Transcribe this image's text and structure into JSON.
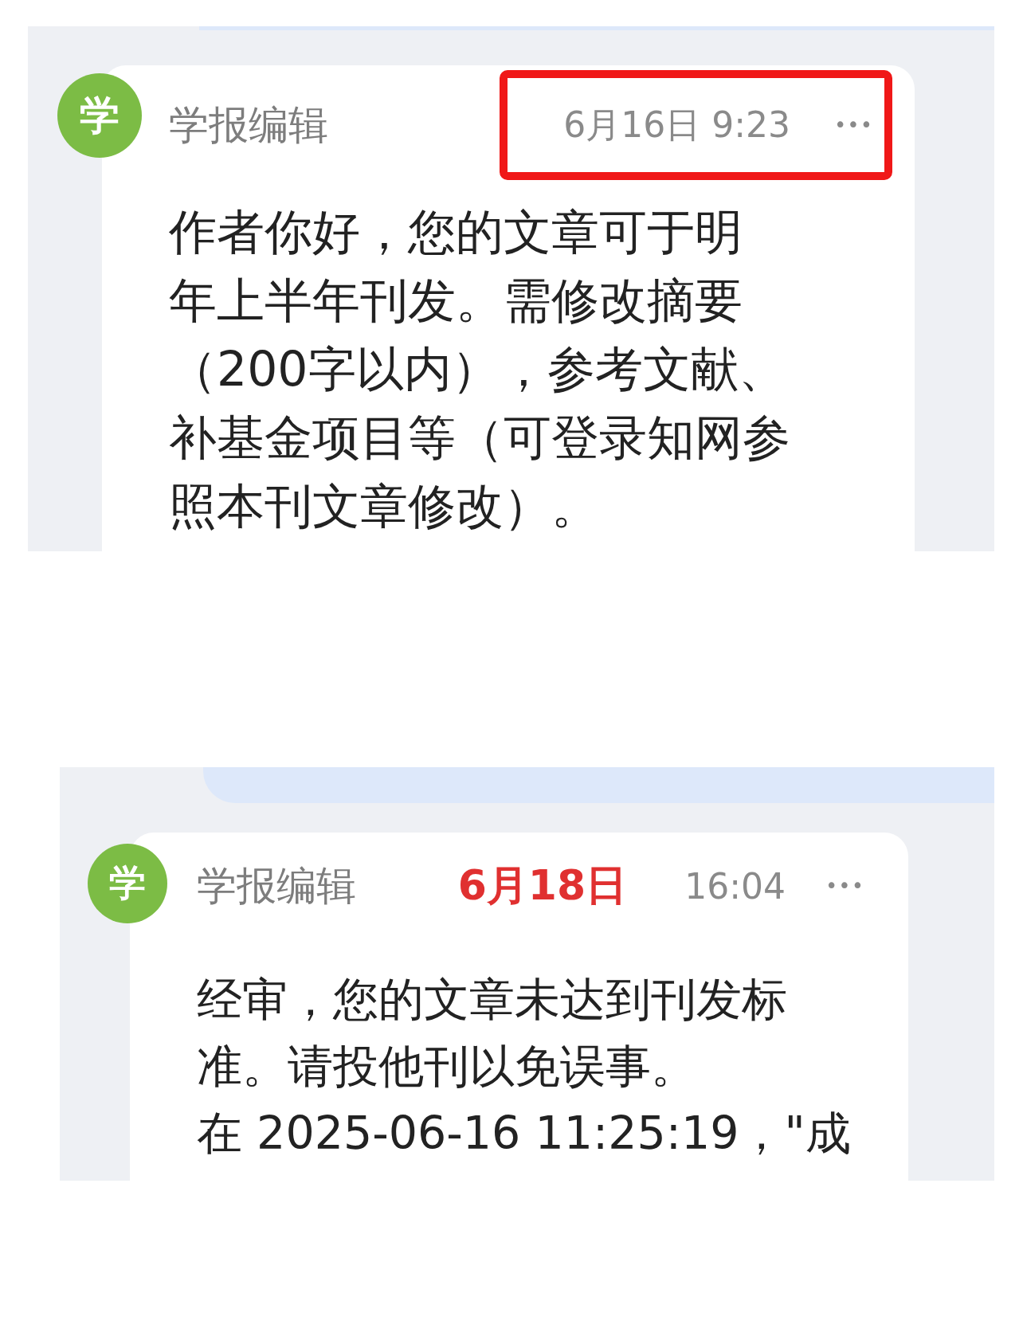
{
  "messages": [
    {
      "avatar": "学",
      "sender": "学报编辑",
      "boxed": true,
      "timestamp": [
        {
          "text": "6月16日 9:23",
          "kind": "plain"
        }
      ],
      "more": "•••",
      "lines": [
        "作者你好，您的文章可于明",
        "年上半年刊发。需修改摘要",
        "（200字以内），参考文献、",
        "补基金项目等（可登录知网参",
        "照本刊文章修改）。"
      ]
    },
    {
      "avatar": "学",
      "sender": "学报编辑",
      "boxed": false,
      "timestamp": [
        {
          "text": "6月18日",
          "kind": "marked"
        },
        {
          "text": "16:04",
          "kind": "plain"
        }
      ],
      "more": "•••",
      "lines": [
        "经审，您的文章未达到刊发标",
        "准。请投他刊以免误事。",
        "在 2025-06-16 11:25:19，\"成"
      ]
    }
  ]
}
